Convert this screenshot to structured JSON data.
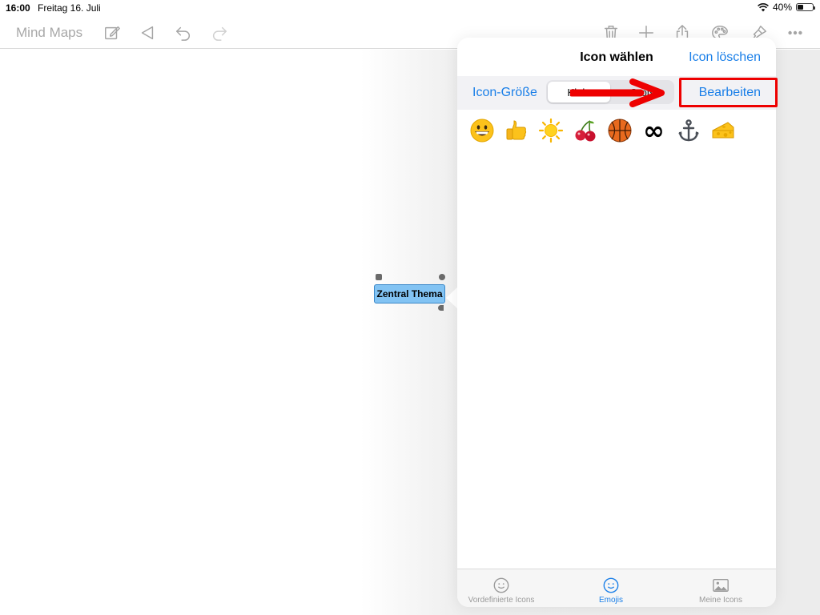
{
  "status_bar": {
    "time": "16:00",
    "date": "Freitag 16. Juli",
    "battery": "40%",
    "battery_level": 0.4
  },
  "toolbar": {
    "title": "Mind Maps",
    "icons": [
      "compose-icon",
      "back-triangle-icon",
      "undo-icon",
      "redo-icon",
      "trash-icon",
      "plus-icon",
      "share-icon",
      "palette-icon",
      "brush-icon",
      "more-icon"
    ]
  },
  "mindmap": {
    "central_topic": "Zentral Thema"
  },
  "popover": {
    "title": "Icon wählen",
    "clear_label": "Icon löschen",
    "size_label": "Icon-Größe",
    "size_options": [
      "Klein",
      "Groß"
    ],
    "selected_size": "Klein",
    "edit_label": "Bearbeiten",
    "emojis": [
      "😀",
      "👍",
      "☀️",
      "🍒",
      "🏀",
      "∞",
      "⚓",
      "🧀"
    ],
    "tabs": [
      {
        "label": "Vordefinierte Icons",
        "selected": false
      },
      {
        "label": "Emojis",
        "selected": true
      },
      {
        "label": "Meine Icons",
        "selected": false
      }
    ]
  },
  "colors": {
    "accent": "#1a7fe8",
    "annotation_red": "#ee0000",
    "node_fill": "#82c3f3"
  }
}
